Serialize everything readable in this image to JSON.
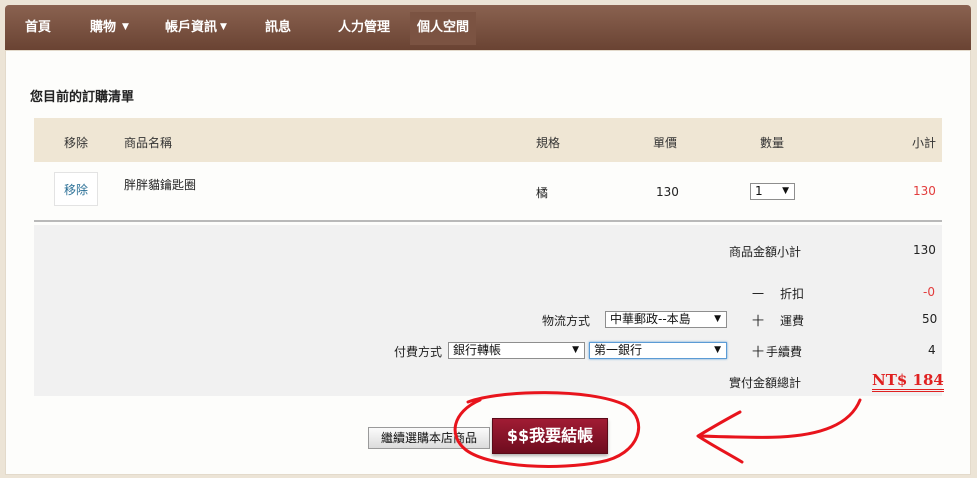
{
  "nav": {
    "items": [
      {
        "label": "首頁",
        "dropdown": false
      },
      {
        "label": "購物",
        "dropdown": true
      },
      {
        "label": "帳戶資訊",
        "dropdown": true
      },
      {
        "label": "訊息",
        "dropdown": false
      },
      {
        "label": "人力管理",
        "dropdown": false
      },
      {
        "label": "個人空間",
        "dropdown": false
      }
    ],
    "caret": "▼"
  },
  "cart": {
    "title": "您目前的訂購清單",
    "headers": {
      "remove": "移除",
      "name": "商品名稱",
      "spec": "規格",
      "price": "單價",
      "qty": "數量",
      "subtotal": "小計"
    },
    "items": [
      {
        "remove_label": "移除",
        "name": "胖胖貓鑰匙圈",
        "spec": "橘",
        "price": "130",
        "qty": "1",
        "subtotal": "130"
      }
    ]
  },
  "summary": {
    "goods_subtotal_label": "商品金額小計",
    "goods_subtotal_value": "130",
    "discount_sign": "一",
    "discount_label": "折扣",
    "discount_value": "-0",
    "logistics_label": "物流方式",
    "logistics_value": "中華郵政--本島",
    "shipping_sign": "十",
    "shipping_label": "運費",
    "shipping_value": "50",
    "payment_label": "付費方式",
    "payment_method_value": "銀行轉帳",
    "bank_value": "第一銀行",
    "fee_sign": "十",
    "fee_label": "手續費",
    "fee_value": "4",
    "total_label": "實付金額總計",
    "total_value": "NT$ 184"
  },
  "buttons": {
    "continue": "繼續選購本店商品",
    "checkout": "$$我要結帳"
  },
  "colors": {
    "nav_bg": "#7b5342",
    "table_header_bg": "#efe6d4",
    "total_red": "#e02020",
    "checkout_bg": "#8a1428",
    "annotation_red": "#e8141c"
  }
}
